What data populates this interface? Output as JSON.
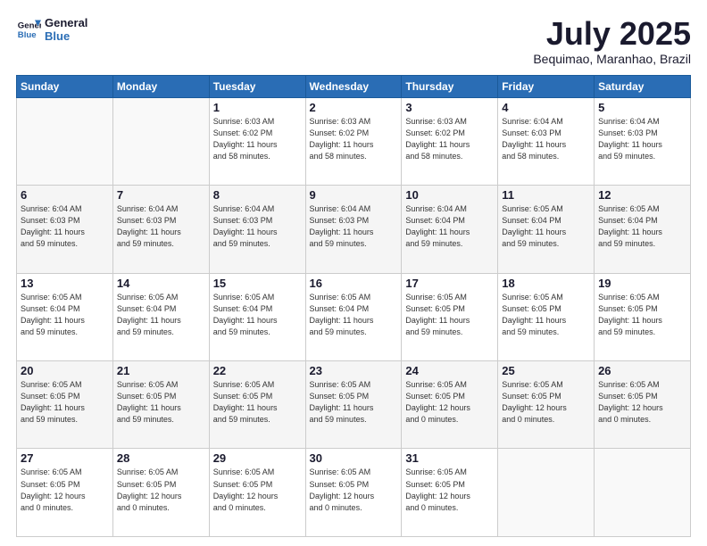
{
  "header": {
    "logo_line1": "General",
    "logo_line2": "Blue",
    "title": "July 2025",
    "location": "Bequimao, Maranhao, Brazil"
  },
  "days_of_week": [
    "Sunday",
    "Monday",
    "Tuesday",
    "Wednesday",
    "Thursday",
    "Friday",
    "Saturday"
  ],
  "weeks": [
    [
      {
        "day": "",
        "info": ""
      },
      {
        "day": "",
        "info": ""
      },
      {
        "day": "1",
        "info": "Sunrise: 6:03 AM\nSunset: 6:02 PM\nDaylight: 11 hours\nand 58 minutes."
      },
      {
        "day": "2",
        "info": "Sunrise: 6:03 AM\nSunset: 6:02 PM\nDaylight: 11 hours\nand 58 minutes."
      },
      {
        "day": "3",
        "info": "Sunrise: 6:03 AM\nSunset: 6:02 PM\nDaylight: 11 hours\nand 58 minutes."
      },
      {
        "day": "4",
        "info": "Sunrise: 6:04 AM\nSunset: 6:03 PM\nDaylight: 11 hours\nand 58 minutes."
      },
      {
        "day": "5",
        "info": "Sunrise: 6:04 AM\nSunset: 6:03 PM\nDaylight: 11 hours\nand 59 minutes."
      }
    ],
    [
      {
        "day": "6",
        "info": "Sunrise: 6:04 AM\nSunset: 6:03 PM\nDaylight: 11 hours\nand 59 minutes."
      },
      {
        "day": "7",
        "info": "Sunrise: 6:04 AM\nSunset: 6:03 PM\nDaylight: 11 hours\nand 59 minutes."
      },
      {
        "day": "8",
        "info": "Sunrise: 6:04 AM\nSunset: 6:03 PM\nDaylight: 11 hours\nand 59 minutes."
      },
      {
        "day": "9",
        "info": "Sunrise: 6:04 AM\nSunset: 6:03 PM\nDaylight: 11 hours\nand 59 minutes."
      },
      {
        "day": "10",
        "info": "Sunrise: 6:04 AM\nSunset: 6:04 PM\nDaylight: 11 hours\nand 59 minutes."
      },
      {
        "day": "11",
        "info": "Sunrise: 6:05 AM\nSunset: 6:04 PM\nDaylight: 11 hours\nand 59 minutes."
      },
      {
        "day": "12",
        "info": "Sunrise: 6:05 AM\nSunset: 6:04 PM\nDaylight: 11 hours\nand 59 minutes."
      }
    ],
    [
      {
        "day": "13",
        "info": "Sunrise: 6:05 AM\nSunset: 6:04 PM\nDaylight: 11 hours\nand 59 minutes."
      },
      {
        "day": "14",
        "info": "Sunrise: 6:05 AM\nSunset: 6:04 PM\nDaylight: 11 hours\nand 59 minutes."
      },
      {
        "day": "15",
        "info": "Sunrise: 6:05 AM\nSunset: 6:04 PM\nDaylight: 11 hours\nand 59 minutes."
      },
      {
        "day": "16",
        "info": "Sunrise: 6:05 AM\nSunset: 6:04 PM\nDaylight: 11 hours\nand 59 minutes."
      },
      {
        "day": "17",
        "info": "Sunrise: 6:05 AM\nSunset: 6:05 PM\nDaylight: 11 hours\nand 59 minutes."
      },
      {
        "day": "18",
        "info": "Sunrise: 6:05 AM\nSunset: 6:05 PM\nDaylight: 11 hours\nand 59 minutes."
      },
      {
        "day": "19",
        "info": "Sunrise: 6:05 AM\nSunset: 6:05 PM\nDaylight: 11 hours\nand 59 minutes."
      }
    ],
    [
      {
        "day": "20",
        "info": "Sunrise: 6:05 AM\nSunset: 6:05 PM\nDaylight: 11 hours\nand 59 minutes."
      },
      {
        "day": "21",
        "info": "Sunrise: 6:05 AM\nSunset: 6:05 PM\nDaylight: 11 hours\nand 59 minutes."
      },
      {
        "day": "22",
        "info": "Sunrise: 6:05 AM\nSunset: 6:05 PM\nDaylight: 11 hours\nand 59 minutes."
      },
      {
        "day": "23",
        "info": "Sunrise: 6:05 AM\nSunset: 6:05 PM\nDaylight: 11 hours\nand 59 minutes."
      },
      {
        "day": "24",
        "info": "Sunrise: 6:05 AM\nSunset: 6:05 PM\nDaylight: 12 hours\nand 0 minutes."
      },
      {
        "day": "25",
        "info": "Sunrise: 6:05 AM\nSunset: 6:05 PM\nDaylight: 12 hours\nand 0 minutes."
      },
      {
        "day": "26",
        "info": "Sunrise: 6:05 AM\nSunset: 6:05 PM\nDaylight: 12 hours\nand 0 minutes."
      }
    ],
    [
      {
        "day": "27",
        "info": "Sunrise: 6:05 AM\nSunset: 6:05 PM\nDaylight: 12 hours\nand 0 minutes."
      },
      {
        "day": "28",
        "info": "Sunrise: 6:05 AM\nSunset: 6:05 PM\nDaylight: 12 hours\nand 0 minutes."
      },
      {
        "day": "29",
        "info": "Sunrise: 6:05 AM\nSunset: 6:05 PM\nDaylight: 12 hours\nand 0 minutes."
      },
      {
        "day": "30",
        "info": "Sunrise: 6:05 AM\nSunset: 6:05 PM\nDaylight: 12 hours\nand 0 minutes."
      },
      {
        "day": "31",
        "info": "Sunrise: 6:05 AM\nSunset: 6:05 PM\nDaylight: 12 hours\nand 0 minutes."
      },
      {
        "day": "",
        "info": ""
      },
      {
        "day": "",
        "info": ""
      }
    ]
  ]
}
